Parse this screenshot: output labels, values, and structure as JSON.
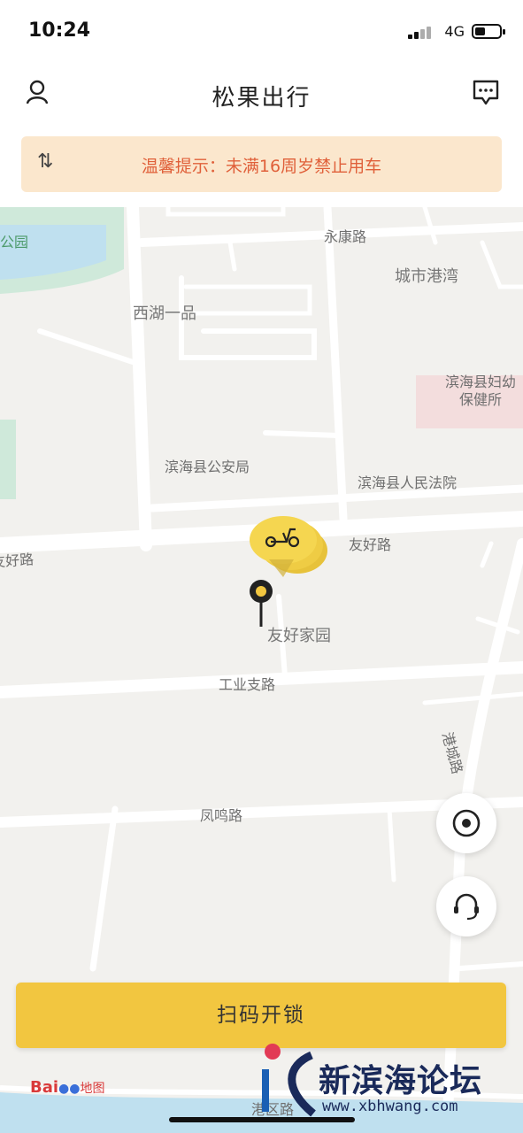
{
  "status": {
    "time": "10:24",
    "network": "4G"
  },
  "header": {
    "title": "松果出行",
    "profile_icon": "user-icon",
    "message_icon": "chat-icon"
  },
  "notice": {
    "text": "温馨提示：未满16周岁禁止用车",
    "icon": "swap-icon"
  },
  "map": {
    "labels": {
      "park": "公园",
      "yongkang": "永康路",
      "chengshi": "城市港湾",
      "xihu": "西湖一品",
      "fuyou": "滨海县妇幼\n保健所",
      "gongan": "滨海县公安局",
      "fayuan": "滨海县人民法院",
      "youhao_left": "友好路",
      "youhao_right": "友好路",
      "jiayuan": "友好家园",
      "gongye": "工业支路",
      "gangcheng": "港城路",
      "fengming": "凤鸣路",
      "gangxing": "港区路"
    }
  },
  "buttons": {
    "scan_unlock": "扫码开锁",
    "locate_icon": "locate-icon",
    "service_icon": "headset-icon"
  },
  "watermark": {
    "baidu": "Bai",
    "baidu_map": "地图",
    "forum": "新滨海论坛",
    "url": "www.xbhwang.com"
  },
  "colors": {
    "accent": "#f2c640",
    "notice_bg": "#fbe7cd",
    "notice_text": "#e0603a"
  }
}
